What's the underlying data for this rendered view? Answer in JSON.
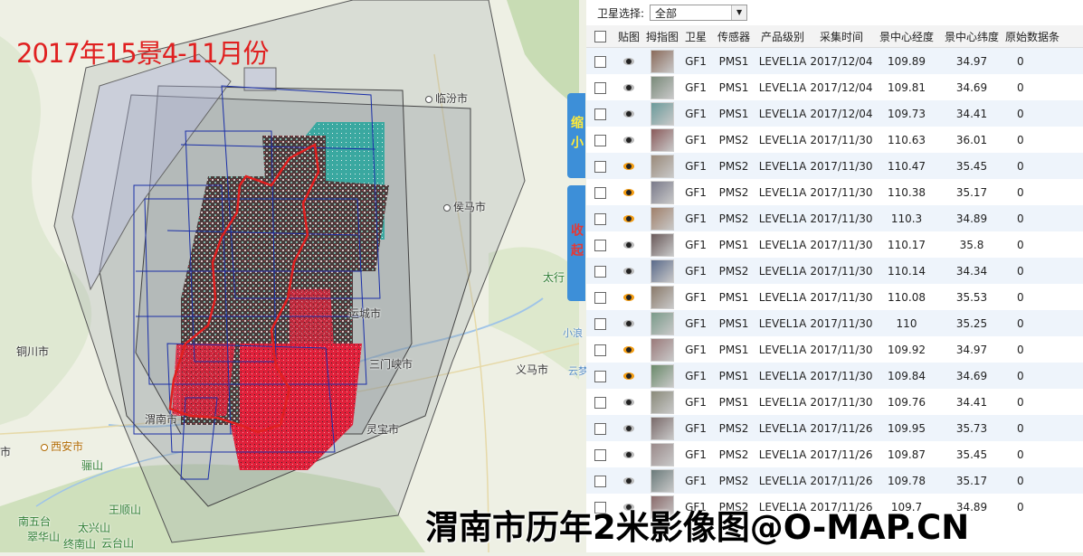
{
  "overlay": {
    "title": "2017年15景4-11月份",
    "watermark": "渭南市历年2米影像图@O-MAP.CN"
  },
  "map_labels": {
    "linfen": "临汾市",
    "houma": "侯马市",
    "yuncheng": "运城市",
    "tongchuan": "铜川市",
    "sanmenxia": "三门峡市",
    "yima": "义马市",
    "weinan": "渭南市",
    "lingbao": "灵宝市",
    "xian": "西安市",
    "lishan": "骊山",
    "wangshunshan": "王顺山",
    "nanwutai": "南五台",
    "taixingshan": "太兴山",
    "cuihuashan": "翠华山",
    "nanshan": "终南山",
    "yuntaishan": "云台山",
    "taihang": "太行",
    "xiaolang": "小浪",
    "yunmeng": "云梦",
    "edge_city": "市"
  },
  "side_tabs": {
    "shrink": "缩小",
    "collapse": "收起"
  },
  "filter": {
    "label": "卫星选择:",
    "selected": "全部"
  },
  "columns": [
    "",
    "贴图",
    "拇指图",
    "卫星",
    "传感器",
    "产品级别",
    "采集时间",
    "景中心经度",
    "景中心纬度",
    "原始数据条"
  ],
  "rows": [
    {
      "sat": "GF1",
      "sensor": "PMS1",
      "level": "LEVEL1A",
      "date": "2017/12/04",
      "lon": "109.89",
      "lat": "34.97",
      "raw": "0",
      "eye": "off"
    },
    {
      "sat": "GF1",
      "sensor": "PMS1",
      "level": "LEVEL1A",
      "date": "2017/12/04",
      "lon": "109.81",
      "lat": "34.69",
      "raw": "0",
      "eye": "off"
    },
    {
      "sat": "GF1",
      "sensor": "PMS1",
      "level": "LEVEL1A",
      "date": "2017/12/04",
      "lon": "109.73",
      "lat": "34.41",
      "raw": "0",
      "eye": "off"
    },
    {
      "sat": "GF1",
      "sensor": "PMS2",
      "level": "LEVEL1A",
      "date": "2017/11/30",
      "lon": "110.63",
      "lat": "36.01",
      "raw": "0",
      "eye": "off"
    },
    {
      "sat": "GF1",
      "sensor": "PMS2",
      "level": "LEVEL1A",
      "date": "2017/11/30",
      "lon": "110.47",
      "lat": "35.45",
      "raw": "0",
      "eye": "on"
    },
    {
      "sat": "GF1",
      "sensor": "PMS2",
      "level": "LEVEL1A",
      "date": "2017/11/30",
      "lon": "110.38",
      "lat": "35.17",
      "raw": "0",
      "eye": "on"
    },
    {
      "sat": "GF1",
      "sensor": "PMS2",
      "level": "LEVEL1A",
      "date": "2017/11/30",
      "lon": "110.3",
      "lat": "34.89",
      "raw": "0",
      "eye": "on"
    },
    {
      "sat": "GF1",
      "sensor": "PMS1",
      "level": "LEVEL1A",
      "date": "2017/11/30",
      "lon": "110.17",
      "lat": "35.8",
      "raw": "0",
      "eye": "off"
    },
    {
      "sat": "GF1",
      "sensor": "PMS2",
      "level": "LEVEL1A",
      "date": "2017/11/30",
      "lon": "110.14",
      "lat": "34.34",
      "raw": "0",
      "eye": "off"
    },
    {
      "sat": "GF1",
      "sensor": "PMS1",
      "level": "LEVEL1A",
      "date": "2017/11/30",
      "lon": "110.08",
      "lat": "35.53",
      "raw": "0",
      "eye": "on"
    },
    {
      "sat": "GF1",
      "sensor": "PMS1",
      "level": "LEVEL1A",
      "date": "2017/11/30",
      "lon": "110",
      "lat": "35.25",
      "raw": "0",
      "eye": "off"
    },
    {
      "sat": "GF1",
      "sensor": "PMS1",
      "level": "LEVEL1A",
      "date": "2017/11/30",
      "lon": "109.92",
      "lat": "34.97",
      "raw": "0",
      "eye": "on"
    },
    {
      "sat": "GF1",
      "sensor": "PMS1",
      "level": "LEVEL1A",
      "date": "2017/11/30",
      "lon": "109.84",
      "lat": "34.69",
      "raw": "0",
      "eye": "on"
    },
    {
      "sat": "GF1",
      "sensor": "PMS1",
      "level": "LEVEL1A",
      "date": "2017/11/30",
      "lon": "109.76",
      "lat": "34.41",
      "raw": "0",
      "eye": "off"
    },
    {
      "sat": "GF1",
      "sensor": "PMS2",
      "level": "LEVEL1A",
      "date": "2017/11/26",
      "lon": "109.95",
      "lat": "35.73",
      "raw": "0",
      "eye": "off"
    },
    {
      "sat": "GF1",
      "sensor": "PMS2",
      "level": "LEVEL1A",
      "date": "2017/11/26",
      "lon": "109.87",
      "lat": "35.45",
      "raw": "0",
      "eye": "off"
    },
    {
      "sat": "GF1",
      "sensor": "PMS2",
      "level": "LEVEL1A",
      "date": "2017/11/26",
      "lon": "109.78",
      "lat": "35.17",
      "raw": "0",
      "eye": "off"
    },
    {
      "sat": "GF1",
      "sensor": "PMS2",
      "level": "LEVEL1A",
      "date": "2017/11/26",
      "lon": "109.7",
      "lat": "34.89",
      "raw": "0",
      "eye": "off"
    }
  ],
  "colors": {
    "accent_blue": "#3d8fd8",
    "footprint_outline": "#1a2fa8",
    "boundary": "#e02020",
    "eye_on": "#f39c12"
  }
}
